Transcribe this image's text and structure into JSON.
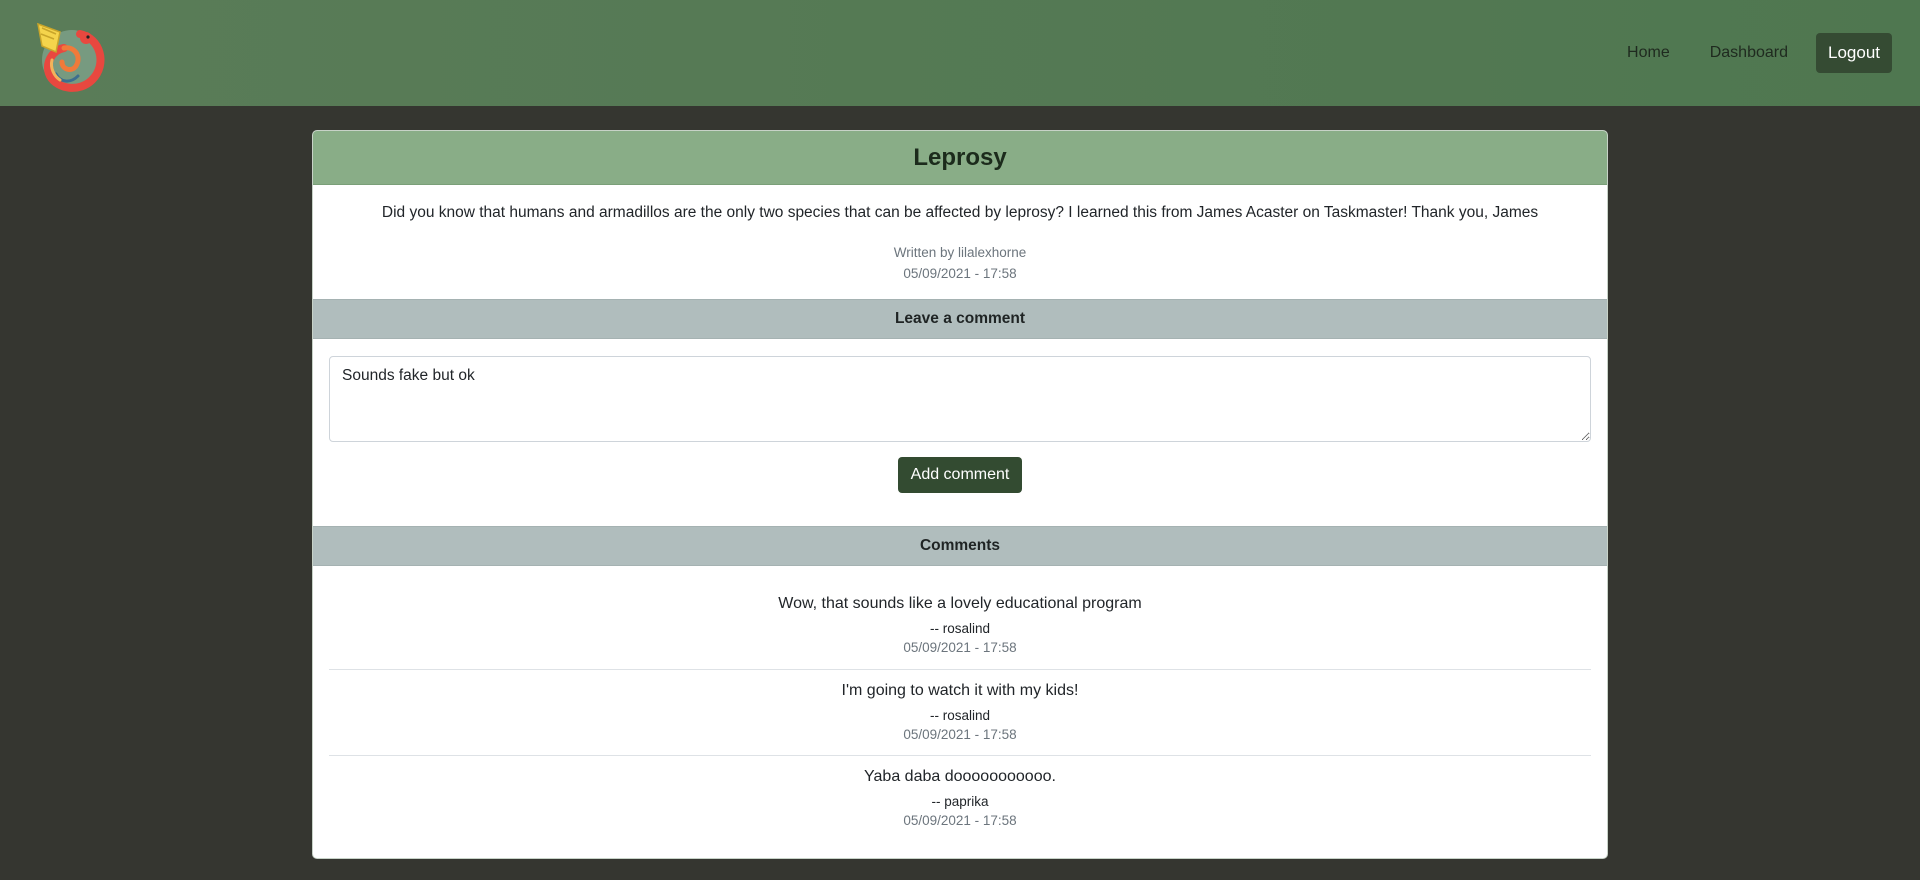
{
  "nav": {
    "home": "Home",
    "dashboard": "Dashboard",
    "logout": "Logout"
  },
  "post": {
    "title": "Leprosy",
    "body": "Did you know that humans and armadillos are the only two species that can be affected by leprosy? I learned this from James Acaster on Taskmaster! Thank you, James",
    "author": "Written by lilalexhorne",
    "date": "05/09/2021 - 17:58"
  },
  "leave_comment": {
    "header": "Leave a comment",
    "value": "Sounds fake but ok",
    "button": "Add comment"
  },
  "comments": {
    "header": "Comments",
    "items": [
      {
        "text": "Wow, that sounds like a lovely educational program",
        "author": "-- rosalind",
        "date": "05/09/2021 - 17:58"
      },
      {
        "text": "I'm going to watch it with my kids!",
        "author": "-- rosalind",
        "date": "05/09/2021 - 17:58"
      },
      {
        "text": "Yaba daba dooooooooooo.",
        "author": "-- paprika",
        "date": "05/09/2021 - 17:58"
      }
    ]
  }
}
